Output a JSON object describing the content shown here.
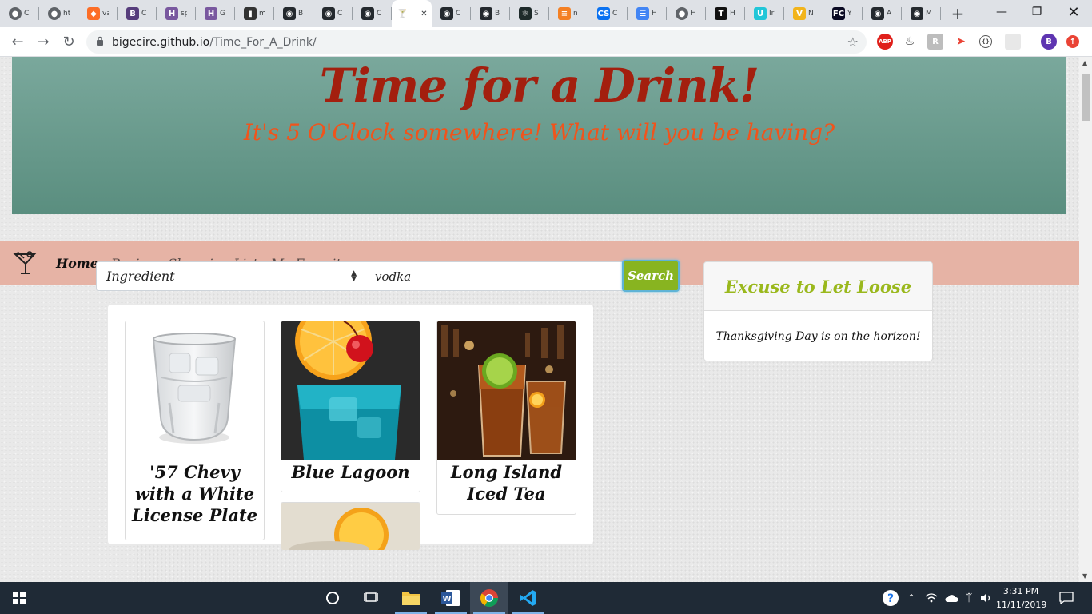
{
  "browser": {
    "tabs": [
      {
        "icon": "chrome-globe-icon",
        "label": "C"
      },
      {
        "icon": "chrome-globe-icon",
        "label": "ht"
      },
      {
        "icon": "gitlab-icon",
        "label": "va"
      },
      {
        "icon": "bootstrap-icon",
        "label": "C"
      },
      {
        "icon": "heroku-icon",
        "label": "sp"
      },
      {
        "icon": "heroku-icon",
        "label": "G"
      },
      {
        "icon": "bookmark-icon",
        "label": "m"
      },
      {
        "icon": "github-icon",
        "label": "B"
      },
      {
        "icon": "github-icon",
        "label": "C"
      },
      {
        "icon": "github-icon",
        "label": "C"
      },
      {
        "icon": "cocktail-icon",
        "label": "",
        "active": true
      },
      {
        "icon": "github-icon",
        "label": "C"
      },
      {
        "icon": "github-icon",
        "label": "B"
      },
      {
        "icon": "react-icon",
        "label": "S"
      },
      {
        "icon": "stackoverflow-icon",
        "label": "n"
      },
      {
        "icon": "codesandbox-icon",
        "label": "C"
      },
      {
        "icon": "google-docs-icon",
        "label": "H"
      },
      {
        "icon": "chrome-globe-icon",
        "label": "H"
      },
      {
        "icon": "nytimes-icon",
        "label": "H"
      },
      {
        "icon": "udemy-icon",
        "label": "Ir"
      },
      {
        "icon": "vue-icon",
        "label": "N"
      },
      {
        "icon": "freecodecamp-icon",
        "label": "Y"
      },
      {
        "icon": "github-icon",
        "label": "A"
      },
      {
        "icon": "github-icon",
        "label": "M"
      }
    ],
    "url_host": "bigecire.github.io",
    "url_path": "/Time_For_A_Drink/",
    "profile_initial": "B"
  },
  "hero": {
    "title": "Time for a Drink!",
    "subtitle": "It's 5 O'Clock somewhere! What will you be having?"
  },
  "nav": {
    "links": [
      "Home",
      "Recipe",
      "Shopping List",
      "My Favorites"
    ]
  },
  "search": {
    "type_selected": "Ingredient",
    "query": "vodka",
    "button_label": "Search"
  },
  "results": [
    {
      "name": "'57 Chevy with a White License Plate",
      "image": "ice-glass-photo"
    },
    {
      "name": "Blue Lagoon",
      "image": "blue-cocktail-photo"
    },
    {
      "name": "Long Island Iced Tea",
      "image": "iced-tea-photo"
    }
  ],
  "excuse": {
    "title": "Excuse to Let Loose",
    "text": "Thanksgiving Day is on the horizon!"
  },
  "taskbar": {
    "time": "3:31 PM",
    "date": "11/11/2019"
  },
  "colors": {
    "hero_bg": "#6a9b8e",
    "title": "#a31f0e",
    "subtitle": "#f0541c",
    "navbar": "#e6b3a5",
    "search_button": "#88b420",
    "excuse_title": "#9ab81c"
  }
}
